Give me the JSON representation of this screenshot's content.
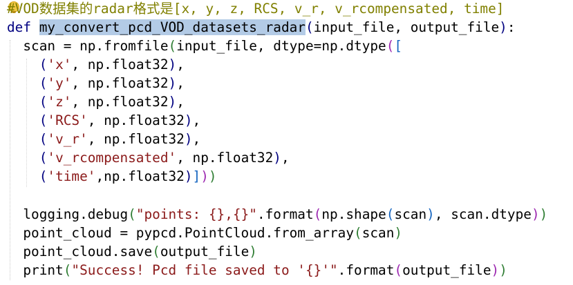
{
  "editor": {
    "comment": "#VOD数据集的radar格式是[x, y, z, RCS, v_r, v_rcompensated, time]",
    "def_keyword": "def",
    "func_name": "my_convert_pcd_VOD_datasets_radar",
    "func_params": "input_file, output_file",
    "colon": ":",
    "lines": {
      "scan_prefix": "scan = np.fromfile",
      "scan_args": "input_file, dtype=np.dtype",
      "fields": [
        {
          "name": "'x'",
          "type": ", np.float32"
        },
        {
          "name": "'y'",
          "type": ", np.float32"
        },
        {
          "name": "'z'",
          "type": ", np.float32"
        },
        {
          "name": "'RCS'",
          "type": ", np.float32"
        },
        {
          "name": "'v_r'",
          "type": ", np.float32"
        },
        {
          "name": "'v_rcompensated'",
          "type": ", np.float32"
        },
        {
          "name": "'time'",
          "type": ",np.float32"
        }
      ],
      "logging_prefix": "logging.debug",
      "logging_fmt": "\"points: {},{}\"",
      "logging_format": ".format",
      "logging_shape": "np.shape",
      "logging_scan": "scan",
      "logging_dtype": ", scan.dtype",
      "pc_prefix": "point_cloud = pypcd.PointCloud.from_array",
      "pc_arg": "scan",
      "save_prefix": "point_cloud.save",
      "save_arg": "output_file",
      "print_prefix": "print",
      "print_str": "\"Success! Pcd file saved to '{}'\"",
      "print_format": ".format",
      "print_arg": "output_file"
    }
  }
}
